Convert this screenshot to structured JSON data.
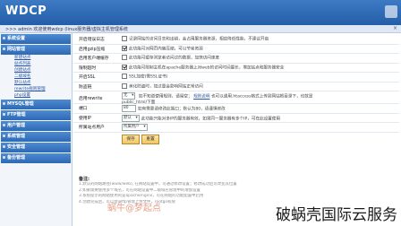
{
  "app": {
    "logo": "WDCP"
  },
  "topbar": {
    "user_text": ">>> admin 欢迎使用wdcp (linux服务器/虚拟主机管理系统",
    "close_glyph": "×"
  },
  "sidebar": {
    "sections": [
      {
        "label": "系统设置"
      },
      {
        "label": "网站管理",
        "items": [
          "新建站点",
          "站点列表",
          "创建站点",
          "二级域名",
          "默认站点",
          "rewrite规则管理",
          "php设置"
        ]
      },
      {
        "label": "MYSQL管理"
      },
      {
        "label": "FTP管理"
      },
      {
        "label": "用户管理"
      },
      {
        "label": "系统管理"
      },
      {
        "label": "安全管理"
      },
      {
        "label": "备份管理"
      }
    ]
  },
  "form": {
    "rows": [
      {
        "label": "开启错误日志",
        "checked": false,
        "text": "记录网站的访问日志和出错，会占用服务器资源，相应降低性能，不建议开启"
      },
      {
        "label": "启用gzip压缩",
        "checked": true,
        "text": "此功能可对网页内容压缩，可以节省资源"
      },
      {
        "label": "启用客户端缓存",
        "checked": false,
        "text": "此功能可缓存浏览者访问过的数据，加快访问速度"
      },
      {
        "label": "限制超时",
        "checked": true,
        "text": "此功能可限制主机在apache服务器上对web的访问时间最长，增加站点和服务器安全"
      },
      {
        "label": "开启SSL",
        "checked": false,
        "text": "SSL加密(需SSL证书)"
      },
      {
        "label": "防盗链",
        "checked": false,
        "text": "美化防盗时，如过量会影响网站正常访问"
      }
    ],
    "rewrite": {
      "label": "启用rewrite",
      "select_value": "无",
      "text_pre": "如不知道使用规则，请留空；",
      "link_text": "规则说明",
      "text_post": "也可以通用.htaccess格式上传到网站根目录下，也就是",
      "line2": "public_html/下面"
    },
    "port": {
      "label": "端口",
      "value": "80",
      "text": "如有需要请修改此端口；默认为80，请谨慎修改"
    },
    "ip": {
      "label": "使用IP",
      "select_value": "默认",
      "text": "此功能只能对多IP的服务器有效，如果同一服务器有多个IP，可在此设置使用"
    },
    "owner": {
      "label": "所属站点用户",
      "select_value": "所属用户"
    },
    "buttons": {
      "save": "保存",
      "reset": "重置"
    }
  },
  "notes": {
    "heading": "备注:",
    "lines": [
      "1.默认的网站路径(www/web), 在网站设置中，可通过修改设置；修改成功后可改变其位置",
      "2.如果需要使用多个域名，可在网站设置中二级域名管理中的增加设置",
      "3.系统提示的网站使用的是apache/nginx，可在网站的功能配置中启用",
      "4.创建完成后，可以登录ftp管理上传文件，rootgo权限"
    ]
  },
  "watermark": {
    "text": "破蜗壳国际云服务",
    "faint": "蜗牛@梦起点"
  }
}
